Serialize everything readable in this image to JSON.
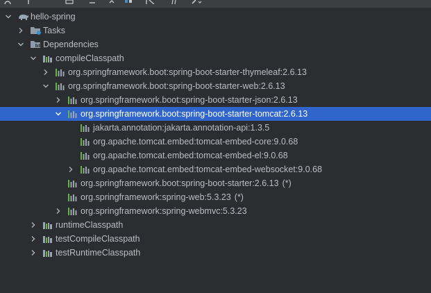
{
  "colors": {
    "background": "#2b2d30",
    "selection": "#2f65ca",
    "text": "#bbbec4",
    "bars_green": "#62b543",
    "bars_gray": "#9aa7b0",
    "folder": "#8f9ba7"
  },
  "tree": [
    {
      "depth": 0,
      "expander": "expanded",
      "icon": "elephant-icon",
      "label": "hello-spring",
      "suffix": ""
    },
    {
      "depth": 1,
      "expander": "collapsed",
      "icon": "tasks-folder-icon",
      "label": "Tasks",
      "suffix": ""
    },
    {
      "depth": 1,
      "expander": "expanded",
      "icon": "dependencies-folder-icon",
      "label": "Dependencies",
      "suffix": ""
    },
    {
      "depth": 2,
      "expander": "expanded",
      "icon": "configuration-icon",
      "label": "compileClasspath",
      "suffix": ""
    },
    {
      "depth": 3,
      "expander": "collapsed",
      "icon": "library-icon",
      "label": "org.springframework.boot:spring-boot-starter-thymeleaf:2.6.13",
      "suffix": ""
    },
    {
      "depth": 3,
      "expander": "expanded",
      "icon": "library-icon",
      "label": "org.springframework.boot:spring-boot-starter-web:2.6.13",
      "suffix": ""
    },
    {
      "depth": 4,
      "expander": "collapsed",
      "icon": "library-icon",
      "label": "org.springframework.boot:spring-boot-starter-json:2.6.13",
      "suffix": ""
    },
    {
      "depth": 4,
      "expander": "expanded",
      "icon": "library-icon",
      "label": "org.springframework.boot:spring-boot-starter-tomcat:2.6.13",
      "suffix": "",
      "selected": true
    },
    {
      "depth": 5,
      "expander": "none",
      "icon": "library-icon",
      "label": "jakarta.annotation:jakarta.annotation-api:1.3.5",
      "suffix": ""
    },
    {
      "depth": 5,
      "expander": "none",
      "icon": "library-icon",
      "label": "org.apache.tomcat.embed:tomcat-embed-core:9.0.68",
      "suffix": ""
    },
    {
      "depth": 5,
      "expander": "none",
      "icon": "library-icon",
      "label": "org.apache.tomcat.embed:tomcat-embed-el:9.0.68",
      "suffix": ""
    },
    {
      "depth": 5,
      "expander": "collapsed",
      "icon": "library-icon",
      "label": "org.apache.tomcat.embed:tomcat-embed-websocket:9.0.68",
      "suffix": ""
    },
    {
      "depth": 4,
      "expander": "none",
      "icon": "library-icon",
      "label": "org.springframework.boot:spring-boot-starter:2.6.13",
      "suffix": "(*)"
    },
    {
      "depth": 4,
      "expander": "none",
      "icon": "library-icon",
      "label": "org.springframework:spring-web:5.3.23",
      "suffix": "(*)"
    },
    {
      "depth": 4,
      "expander": "collapsed",
      "icon": "library-icon",
      "label": "org.springframework:spring-webmvc:5.3.23",
      "suffix": ""
    },
    {
      "depth": 2,
      "expander": "collapsed",
      "icon": "configuration-icon",
      "label": "runtimeClasspath",
      "suffix": ""
    },
    {
      "depth": 2,
      "expander": "collapsed",
      "icon": "configuration-icon",
      "label": "testCompileClasspath",
      "suffix": ""
    },
    {
      "depth": 2,
      "expander": "collapsed",
      "icon": "configuration-icon",
      "label": "testRuntimeClasspath",
      "suffix": ""
    }
  ]
}
